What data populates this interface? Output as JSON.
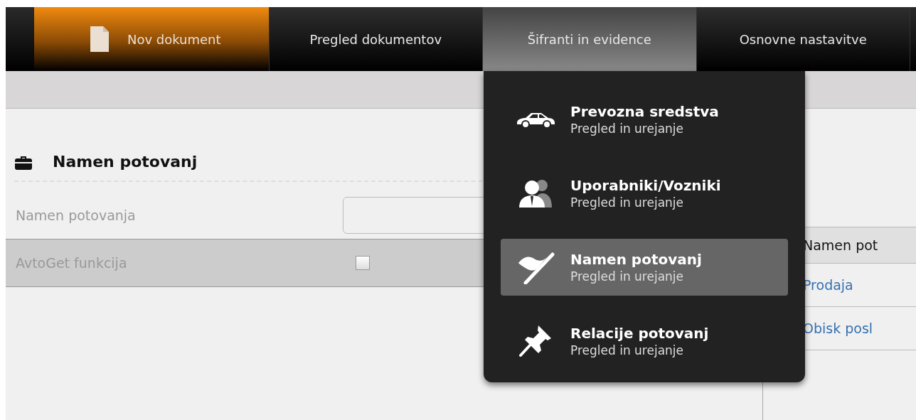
{
  "nav": {
    "tabs": [
      {
        "label": "Nov dokument",
        "kind": "document",
        "selected": true,
        "expanded": false
      },
      {
        "label": "Pregled dokumentov",
        "kind": "plain",
        "selected": false,
        "expanded": false
      },
      {
        "label": "Šifranti in evidence",
        "kind": "plain",
        "selected": false,
        "expanded": true
      },
      {
        "label": "Osnovne nastavitve",
        "kind": "plain",
        "selected": false,
        "expanded": false
      }
    ]
  },
  "dropdown": {
    "items": [
      {
        "kind": "car",
        "title": "Prevozna sredstva",
        "subtitle": "Pregled in urejanje",
        "selected": false
      },
      {
        "kind": "people",
        "title": "Uporabniki/Vozniki",
        "subtitle": "Pregled in urejanje",
        "selected": false
      },
      {
        "kind": "flag",
        "title": "Namen potovanj",
        "subtitle": "Pregled in urejanje",
        "selected": true
      },
      {
        "kind": "pin",
        "title": "Relacije potovanj",
        "subtitle": "Pregled in urejanje",
        "selected": false
      }
    ]
  },
  "form": {
    "title": "Namen potovanj",
    "fields": [
      {
        "kind": "text",
        "label": "Namen potovanja"
      },
      {
        "kind": "checkbox",
        "label": "AvtoGet funkcija",
        "checked": false
      }
    ]
  },
  "table": {
    "columns": [
      "Namen pot"
    ],
    "rows": [
      {
        "cells": [
          "Prodaja"
        ]
      },
      {
        "cells": [
          "Obisk posl"
        ]
      }
    ]
  }
}
